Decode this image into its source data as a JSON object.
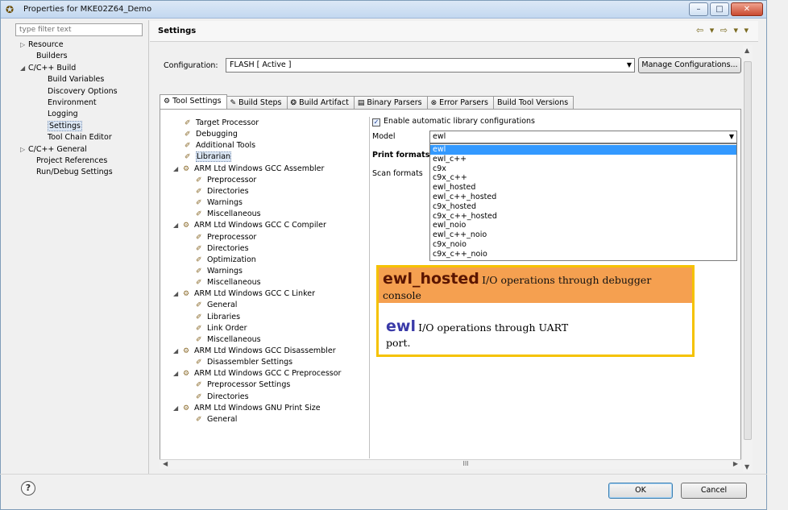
{
  "window": {
    "title": "Properties for MKE02Z64_Demo",
    "controls": [
      "–",
      "□",
      "✕"
    ]
  },
  "filter": {
    "placeholder": "type filter text"
  },
  "nav": [
    {
      "label": "Resource",
      "twisty": "▷"
    },
    {
      "label": "Builders",
      "twisty": ""
    },
    {
      "label": "C/C++ Build",
      "twisty": "◢"
    },
    {
      "label": "Build Variables",
      "twisty": ""
    },
    {
      "label": "Discovery Options",
      "twisty": ""
    },
    {
      "label": "Environment",
      "twisty": ""
    },
    {
      "label": "Logging",
      "twisty": ""
    },
    {
      "label": "Settings",
      "twisty": "",
      "selected": true
    },
    {
      "label": "Tool Chain Editor",
      "twisty": ""
    },
    {
      "label": "C/C++ General",
      "twisty": "▷"
    },
    {
      "label": "Project References",
      "twisty": ""
    },
    {
      "label": "Run/Debug Settings",
      "twisty": ""
    }
  ],
  "settings": {
    "title": "Settings"
  },
  "configuration": {
    "label": "Configuration:",
    "value": "FLASH  [ Active ]",
    "manage_label": "Manage Configurations..."
  },
  "tabs": [
    {
      "label": "Tool Settings",
      "icon": "⚙",
      "active": true
    },
    {
      "label": "Build Steps",
      "icon": "✎"
    },
    {
      "label": "Build Artifact",
      "icon": "❂"
    },
    {
      "label": "Binary Parsers",
      "icon": "▤"
    },
    {
      "label": "Error Parsers",
      "icon": "⊗"
    },
    {
      "label": "Build Tool Versions",
      "icon": ""
    }
  ],
  "tree": [
    {
      "label": "Target Processor",
      "level": 1
    },
    {
      "label": "Debugging",
      "level": 1
    },
    {
      "label": "Additional Tools",
      "level": 1
    },
    {
      "label": "Librarian",
      "level": 1,
      "selected": true
    },
    {
      "label": "ARM Ltd Windows GCC Assembler",
      "level": 0,
      "twisty": "◢"
    },
    {
      "label": "Preprocessor",
      "level": 2
    },
    {
      "label": "Directories",
      "level": 2
    },
    {
      "label": "Warnings",
      "level": 2
    },
    {
      "label": "Miscellaneous",
      "level": 2
    },
    {
      "label": "ARM Ltd Windows GCC C Compiler",
      "level": 0,
      "twisty": "◢"
    },
    {
      "label": "Preprocessor",
      "level": 2
    },
    {
      "label": "Directories",
      "level": 2
    },
    {
      "label": "Optimization",
      "level": 2
    },
    {
      "label": "Warnings",
      "level": 2
    },
    {
      "label": "Miscellaneous",
      "level": 2
    },
    {
      "label": "ARM Ltd Windows GCC C Linker",
      "level": 0,
      "twisty": "◢"
    },
    {
      "label": "General",
      "level": 2
    },
    {
      "label": "Libraries",
      "level": 2
    },
    {
      "label": "Link Order",
      "level": 2
    },
    {
      "label": "Miscellaneous",
      "level": 2
    },
    {
      "label": "ARM Ltd Windows GCC Disassembler",
      "level": 0,
      "twisty": "◢"
    },
    {
      "label": "Disassembler Settings",
      "level": 2
    },
    {
      "label": "ARM Ltd Windows GCC C Preprocessor",
      "level": 0,
      "twisty": "◢"
    },
    {
      "label": "Preprocessor Settings",
      "level": 2
    },
    {
      "label": "Directories",
      "level": 2
    },
    {
      "label": "ARM Ltd Windows GNU Print Size",
      "level": 0,
      "twisty": "◢"
    },
    {
      "label": "General",
      "level": 2
    }
  ],
  "librarian": {
    "auto_lib_label": "Enable automatic library configurations",
    "auto_lib_checked": true,
    "model_label": "Model",
    "model_value": "ewl",
    "print_formats_label": "Print formats",
    "scan_formats_label": "Scan formats",
    "model_options": [
      "ewl",
      "ewl_c++",
      "c9x",
      "c9x_c++",
      "ewl_hosted",
      "ewl_c++_hosted",
      "c9x_hosted",
      "c9x_c++_hosted",
      "ewl_noio",
      "ewl_c++_noio",
      "c9x_noio",
      "c9x_c++_noio"
    ],
    "highlighted_index": 0
  },
  "annotation": {
    "hosted_term": "ewl_hosted",
    "hosted_desc": "I/O operations through debugger",
    "hosted_desc2": "console",
    "ewl_term": "ewl",
    "ewl_desc": "I/O operations through UART",
    "ewl_desc2": "port.",
    "colors": {
      "border": "#f5c200",
      "highlight": "#f5a050",
      "hosted_term": "#5a1500",
      "ewl_term": "#3a3aa8"
    }
  },
  "scrollbar": {
    "thumb_glyph": "III"
  },
  "footer": {
    "help_glyph": "?",
    "ok_label": "OK",
    "cancel_label": "Cancel"
  }
}
